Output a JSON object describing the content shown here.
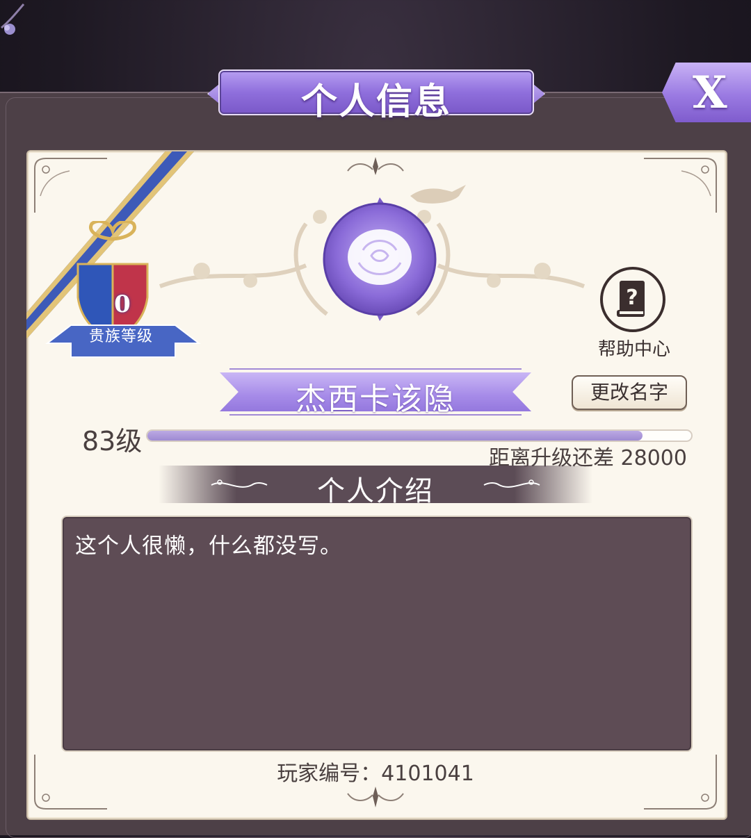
{
  "header": {
    "title": "个人信息",
    "close_label": "X"
  },
  "badge": {
    "level": "0",
    "label": "贵族等级",
    "colors": {
      "left": "#2f56b8",
      "right": "#c0344a",
      "sash": "#3d5ab8"
    }
  },
  "avatar": {
    "icon": "rose-icon",
    "color": "#8a6bd8"
  },
  "help": {
    "label": "帮助中心",
    "icon": "help-book-icon"
  },
  "profile": {
    "name": "杰西卡该隐",
    "rename_label": "更改名字",
    "level_label": "83级",
    "xp_progress": 0.91,
    "xp_remaining_text": "距离升级还差 28000"
  },
  "bio": {
    "section_title": "个人介绍",
    "text": "这个人很懒，什么都没写。"
  },
  "footer": {
    "player_id_text": "玩家编号：4101041"
  },
  "theme": {
    "accent": "#9a7ae2",
    "parchment": "#fbf7ee",
    "panel": "#4d4047",
    "bio_bg": "#5e4c55"
  }
}
